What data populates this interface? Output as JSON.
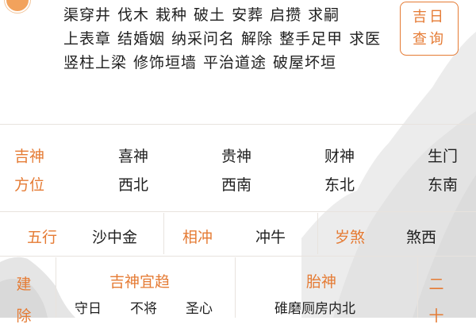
{
  "yi_section": {
    "items": [
      "渠穿井",
      "伐木",
      "栽种",
      "破土",
      "安葬",
      "启攒",
      "求嗣",
      "上表章",
      "结婚姻",
      "纳采问名",
      "解除",
      "整手足甲",
      "求医",
      "竖柱上梁",
      "修饰垣墙",
      "平治道途",
      "破屋坏垣"
    ]
  },
  "query_button": {
    "line1": "吉日",
    "line2": "查询"
  },
  "directions": {
    "labels": [
      "吉神",
      "方位"
    ],
    "columns": [
      {
        "name": "喜神",
        "dir": "西北"
      },
      {
        "name": "贵神",
        "dir": "西南"
      },
      {
        "name": "财神",
        "dir": "东北"
      },
      {
        "name": "生门",
        "dir": "东南"
      }
    ]
  },
  "attributes": {
    "wuxing_label": "五行",
    "wuxing_value": "沙中金",
    "xiangchong_label": "相冲",
    "xiangchong_value": "冲牛",
    "suisha_label": "岁煞",
    "suisha_value": "煞西"
  },
  "bottom": {
    "left_label": [
      "建",
      "除"
    ],
    "jishen_label": "吉神宜趋",
    "jishen_items": [
      "守日",
      "不将",
      "圣心"
    ],
    "taishen_label": "胎神",
    "taishen_value": "碓磨厕房内北",
    "right_label": [
      "二",
      "十"
    ]
  },
  "colors": {
    "accent": "#e57b34",
    "text": "#1f1f1f",
    "divider": "#e8e3de"
  }
}
